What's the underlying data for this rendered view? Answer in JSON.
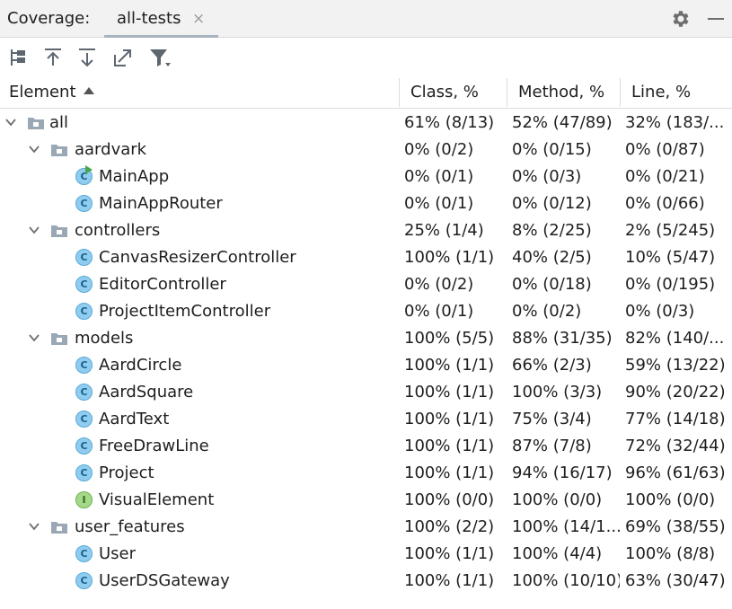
{
  "panel": {
    "title": "Coverage:",
    "tab_label": "all-tests",
    "tab_close": "×"
  },
  "toolbar": {
    "buttons": [
      "flatten-packages",
      "navigate-up",
      "navigate-down",
      "export",
      "filter"
    ]
  },
  "columns": {
    "element": "Element",
    "class": "Class, %",
    "method": "Method, %",
    "line": "Line, %",
    "sort": "ascending"
  },
  "colors": {
    "class_icon": "#8fcdf0",
    "interface_icon": "#a6d88a",
    "folder_icon": "#9aa7b4",
    "header_border": "#dcdcdc"
  },
  "rows": [
    {
      "name": "all",
      "kind": "folder",
      "depth": 0,
      "expanded": true,
      "class": "61% (8/13)",
      "method": "52% (47/89)",
      "line": "32% (183/..."
    },
    {
      "name": "aardvark",
      "kind": "folder",
      "depth": 1,
      "expanded": true,
      "class": "0% (0/2)",
      "method": "0% (0/15)",
      "line": "0% (0/87)"
    },
    {
      "name": "MainApp",
      "kind": "class-run",
      "depth": 2,
      "class": "0% (0/1)",
      "method": "0% (0/3)",
      "line": "0% (0/21)"
    },
    {
      "name": "MainAppRouter",
      "kind": "class",
      "depth": 2,
      "class": "0% (0/1)",
      "method": "0% (0/12)",
      "line": "0% (0/66)"
    },
    {
      "name": "controllers",
      "kind": "folder",
      "depth": 1,
      "expanded": true,
      "class": "25% (1/4)",
      "method": "8% (2/25)",
      "line": "2% (5/245)"
    },
    {
      "name": "CanvasResizerController",
      "kind": "class",
      "depth": 2,
      "class": "100% (1/1)",
      "method": "40% (2/5)",
      "line": "10% (5/47)"
    },
    {
      "name": "EditorController",
      "kind": "class",
      "depth": 2,
      "class": "0% (0/2)",
      "method": "0% (0/18)",
      "line": "0% (0/195)"
    },
    {
      "name": "ProjectItemController",
      "kind": "class",
      "depth": 2,
      "class": "0% (0/1)",
      "method": "0% (0/2)",
      "line": "0% (0/3)"
    },
    {
      "name": "models",
      "kind": "folder",
      "depth": 1,
      "expanded": true,
      "class": "100% (5/5)",
      "method": "88% (31/35)",
      "line": "82% (140/..."
    },
    {
      "name": "AardCircle",
      "kind": "class",
      "depth": 2,
      "class": "100% (1/1)",
      "method": "66% (2/3)",
      "line": "59% (13/22)"
    },
    {
      "name": "AardSquare",
      "kind": "class",
      "depth": 2,
      "class": "100% (1/1)",
      "method": "100% (3/3)",
      "line": "90% (20/22)"
    },
    {
      "name": "AardText",
      "kind": "class",
      "depth": 2,
      "class": "100% (1/1)",
      "method": "75% (3/4)",
      "line": "77% (14/18)"
    },
    {
      "name": "FreeDrawLine",
      "kind": "class",
      "depth": 2,
      "class": "100% (1/1)",
      "method": "87% (7/8)",
      "line": "72% (32/44)"
    },
    {
      "name": "Project",
      "kind": "class",
      "depth": 2,
      "class": "100% (1/1)",
      "method": "94% (16/17)",
      "line": "96% (61/63)"
    },
    {
      "name": "VisualElement",
      "kind": "interface",
      "depth": 2,
      "class": "100% (0/0)",
      "method": "100% (0/0)",
      "line": "100% (0/0)"
    },
    {
      "name": "user_features",
      "kind": "folder",
      "depth": 1,
      "expanded": true,
      "class": "100% (2/2)",
      "method": "100% (14/1...",
      "line": "69% (38/55)"
    },
    {
      "name": "User",
      "kind": "class",
      "depth": 2,
      "class": "100% (1/1)",
      "method": "100% (4/4)",
      "line": "100% (8/8)"
    },
    {
      "name": "UserDSGateway",
      "kind": "class",
      "depth": 2,
      "class": "100% (1/1)",
      "method": "100% (10/10)",
      "line": "63% (30/47)"
    }
  ]
}
